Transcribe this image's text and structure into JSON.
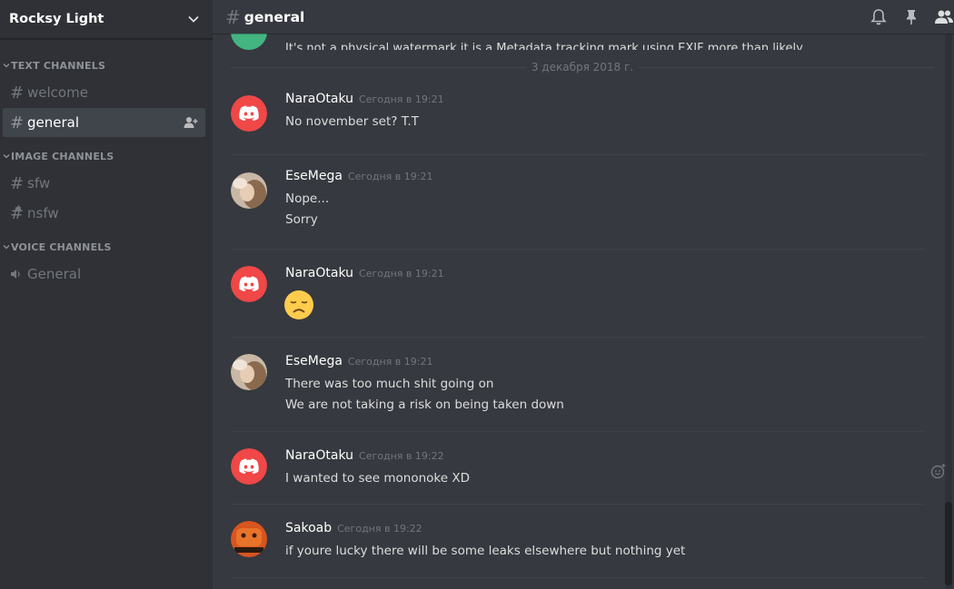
{
  "server": {
    "name": "Rocksy Light"
  },
  "sidebar": {
    "categories": [
      {
        "label": "TEXT CHANNELS",
        "channels": [
          {
            "name": "welcome"
          },
          {
            "name": "general"
          }
        ]
      },
      {
        "label": "IMAGE CHANNELS",
        "channels": [
          {
            "name": "sfw"
          },
          {
            "name": "nsfw"
          }
        ]
      },
      {
        "label": "VOICE CHANNELS",
        "channels": [
          {
            "name": "General"
          }
        ]
      }
    ]
  },
  "channel_header": {
    "title": "general"
  },
  "messages": {
    "partial_text": "It's not a physical watermark it is a Metadata tracking mark using EXIF more than likely.",
    "date_divider": "3 декабря 2018 г.",
    "list": [
      {
        "author": "NaraOtaku",
        "time": "Сегодня в 19:21",
        "lines": [
          "No november set? T.T"
        ]
      },
      {
        "author": "EseMega",
        "time": "Сегодня в 19:21",
        "lines": [
          "Nope...",
          "Sorry"
        ]
      },
      {
        "author": "NaraOtaku",
        "time": "Сегодня в 19:21",
        "lines": []
      },
      {
        "author": "EseMega",
        "time": "Сегодня в 19:21",
        "lines": [
          "There was too much shit going on",
          "We are not taking a risk on being taken down"
        ]
      },
      {
        "author": "NaraOtaku",
        "time": "Сегодня в 19:22",
        "lines": [
          "I wanted to see mononoke XD"
        ]
      },
      {
        "author": "Sakoab",
        "time": "Сегодня в 19:22",
        "lines": [
          "if youre lucky there will be some leaks elsewhere but nothing yet"
        ]
      }
    ]
  },
  "colors": {
    "sidebar_bg": "#2f3136",
    "main_bg": "#36393f",
    "discord_red": "#f04747",
    "active_channel_bg": "#40444b"
  },
  "icons": {
    "header": [
      "bell-icon",
      "pin-icon",
      "members-icon"
    ],
    "channel_invite": "add-member-icon"
  }
}
